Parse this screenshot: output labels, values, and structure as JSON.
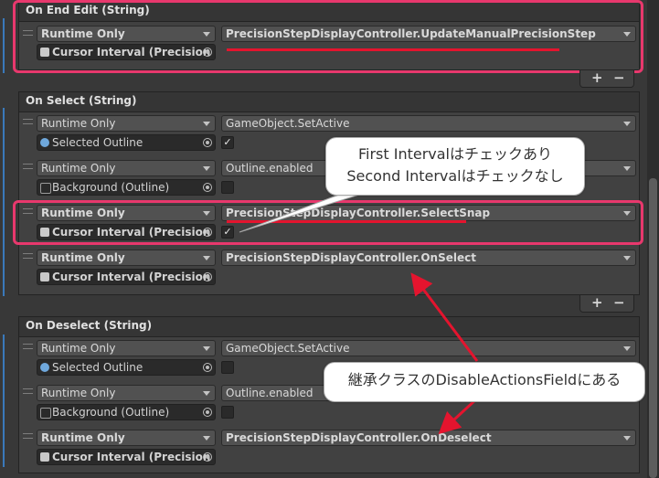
{
  "colors": {
    "highlight": "#e8386d",
    "underline": "#e4142e",
    "arrow": "#e4142e",
    "accent_blue": "#3a79bb"
  },
  "on_end_edit": {
    "title": "On End Edit (String)",
    "rows": [
      {
        "mode": "Runtime Only",
        "target": "Cursor Interval (Precision St",
        "target_icon": "script-icon",
        "method": "PrecisionStepDisplayController.UpdateManualPrecisionStep"
      }
    ]
  },
  "on_select": {
    "title": "On Select (String)",
    "rows": [
      {
        "mode": "Runtime Only",
        "target": "Selected Outline",
        "target_icon": "gameobject-icon",
        "method": "GameObject.SetActive",
        "checked": true
      },
      {
        "mode": "Runtime Only",
        "target": "Background (Outline)",
        "target_icon": "outline-icon",
        "method": "Outline.enabled",
        "checked": false
      },
      {
        "mode": "Runtime Only",
        "target": "Cursor Interval (Precision St",
        "target_icon": "script-icon",
        "method": "PrecisionStepDisplayController.SelectSnap",
        "checked": true
      },
      {
        "mode": "Runtime Only",
        "target": "Cursor Interval (Precision St",
        "target_icon": "script-icon",
        "method": "PrecisionStepDisplayController.OnSelect"
      }
    ]
  },
  "on_deselect": {
    "title": "On Deselect (String)",
    "rows": [
      {
        "mode": "Runtime Only",
        "target": "Selected Outline",
        "target_icon": "gameobject-icon",
        "method": "GameObject.SetActive",
        "checked": false
      },
      {
        "mode": "Runtime Only",
        "target": "Background (Outline)",
        "target_icon": "outline-icon",
        "method": "Outline.enabled",
        "checked": false
      },
      {
        "mode": "Runtime Only",
        "target": "Cursor Interval (Precision St",
        "target_icon": "script-icon",
        "method": "PrecisionStepDisplayController.OnDeselect"
      }
    ]
  },
  "buttons": {
    "add": "+",
    "remove": "−"
  },
  "callout_interval": {
    "line1": "First Intervalはチェックあり",
    "line2": "Second Intervalはチェックなし"
  },
  "callout_inherit": {
    "text": "継承クラスのDisableActionsFieldにある"
  }
}
